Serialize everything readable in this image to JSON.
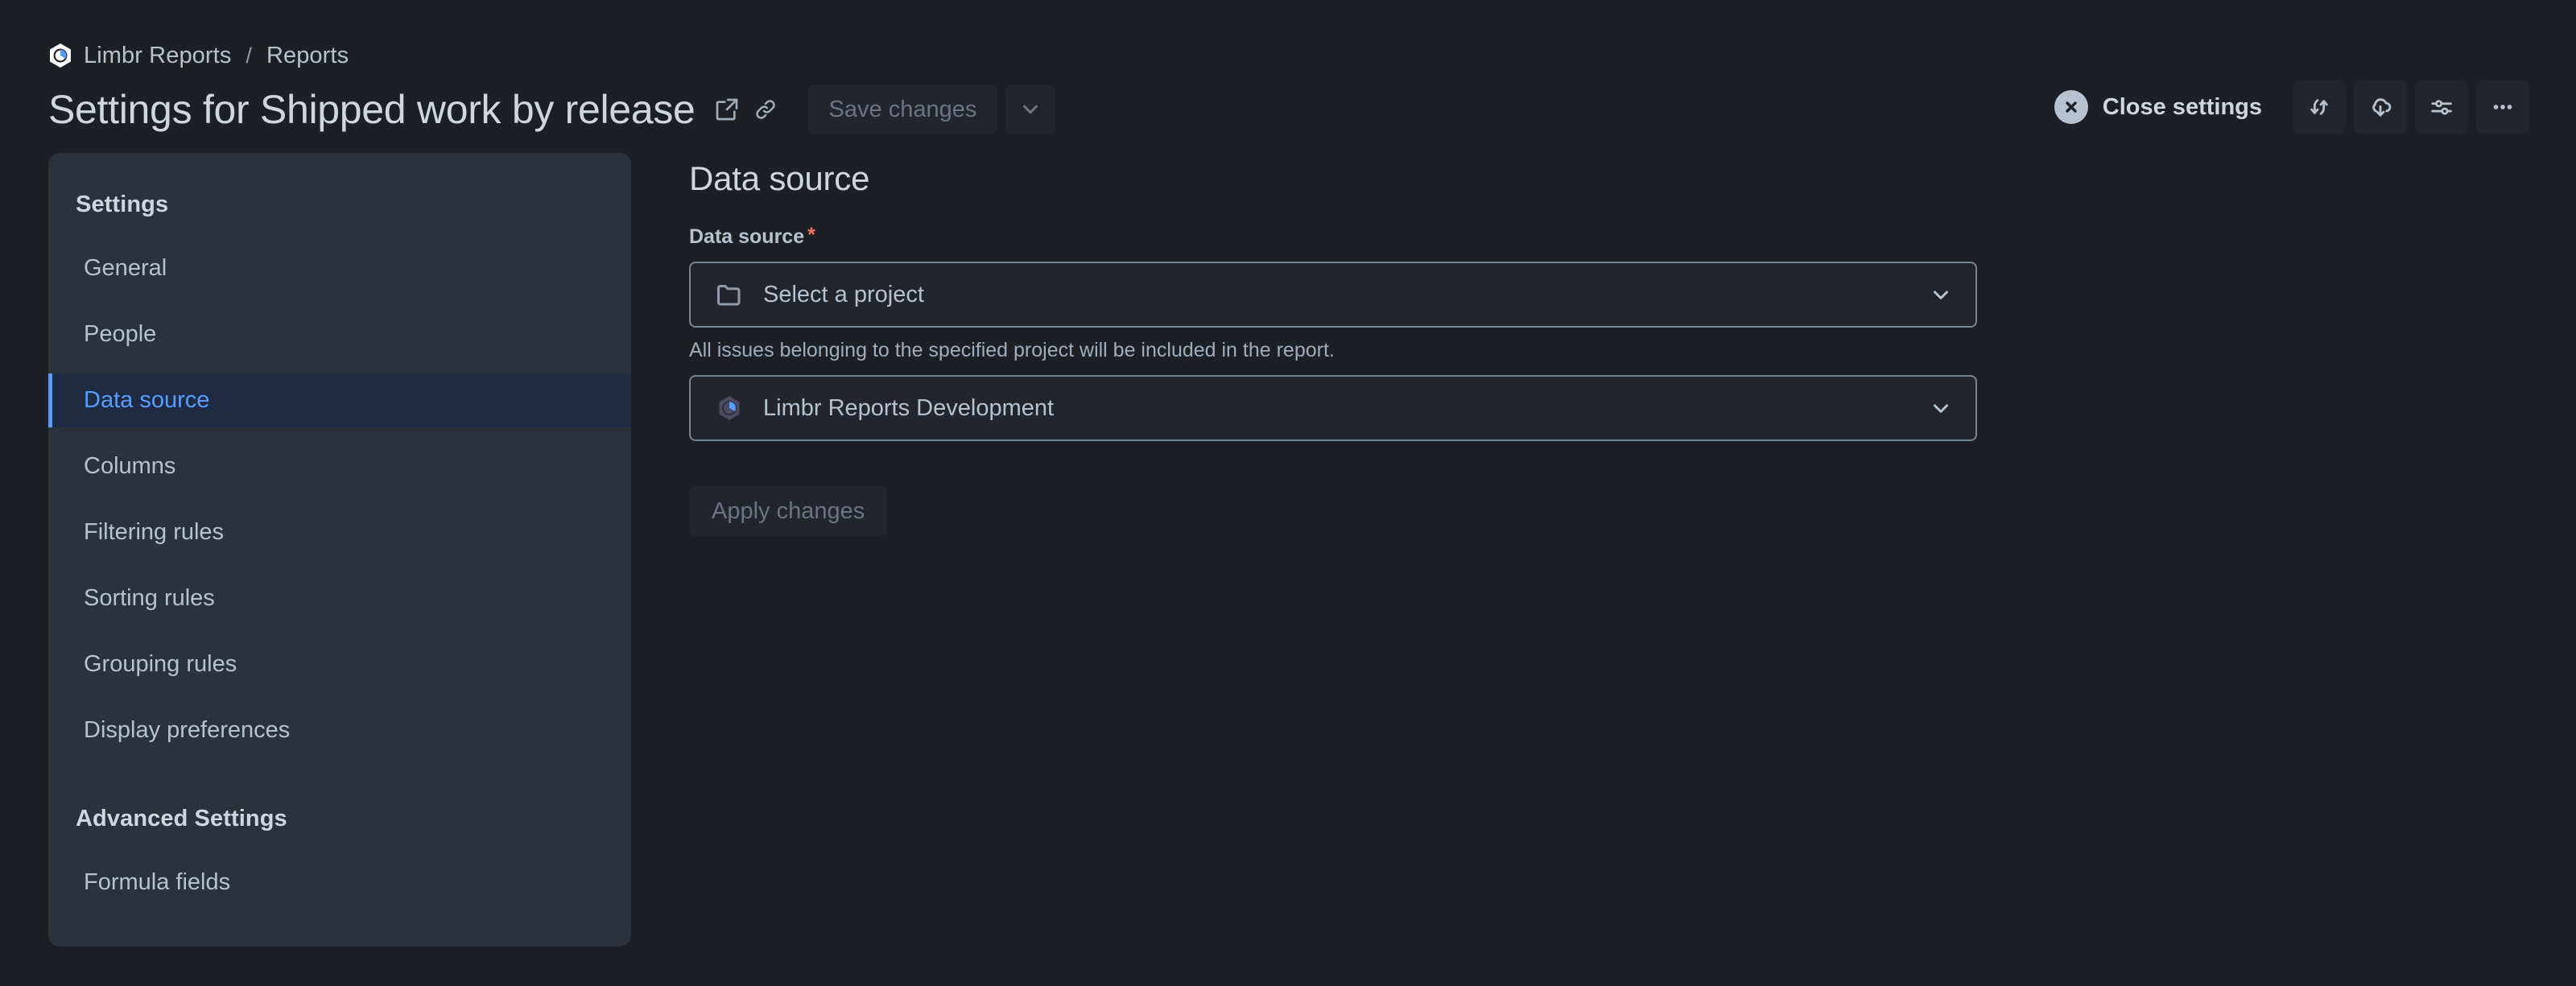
{
  "breadcrumb": {
    "logo_icon": "limbr-hexagon-logo-icon",
    "items": [
      "Limbr Reports",
      "Reports"
    ],
    "separator": "/"
  },
  "header": {
    "title": "Settings for Shipped work by release",
    "open_in_new_icon": "external-link-icon",
    "copy_link_icon": "link-chain-icon",
    "save_label": "Save changes",
    "save_disabled": true,
    "save_caret_icon": "chevron-down-icon",
    "close_settings_label": "Close settings",
    "close_settings_icon": "close-circle-icon",
    "actions": [
      {
        "name": "refresh",
        "icon": "refresh-sync-icon"
      },
      {
        "name": "download",
        "icon": "cloud-download-icon"
      },
      {
        "name": "filters",
        "icon": "sliders-settings-icon"
      },
      {
        "name": "more",
        "icon": "ellipsis-more-icon"
      }
    ]
  },
  "sidebar": {
    "sections": [
      {
        "heading": "Settings",
        "items": [
          {
            "label": "General",
            "active": false
          },
          {
            "label": "People",
            "active": false
          },
          {
            "label": "Data source",
            "active": true
          },
          {
            "label": "Columns",
            "active": false
          },
          {
            "label": "Filtering rules",
            "active": false
          },
          {
            "label": "Sorting rules",
            "active": false
          },
          {
            "label": "Grouping rules",
            "active": false
          },
          {
            "label": "Display preferences",
            "active": false
          }
        ]
      },
      {
        "heading": "Advanced Settings",
        "items": [
          {
            "label": "Formula fields",
            "active": false
          }
        ]
      }
    ]
  },
  "main": {
    "section_title": "Data source",
    "field_label": "Data source",
    "required_marker": "*",
    "project_select": {
      "value": "Select a project",
      "icon": "folder-icon",
      "caret_icon": "chevron-down-icon"
    },
    "helper_text": "All issues belonging to the specified project will be included in the report.",
    "source_select": {
      "value": "Limbr Reports Development",
      "icon": "limbr-hexagon-logo-icon",
      "caret_icon": "chevron-down-icon"
    },
    "apply_label": "Apply changes",
    "apply_disabled": true
  },
  "colors": {
    "page_background": "#1c1f24",
    "sidebar_background": "#2c323b",
    "active_item_background": "#1e2b42",
    "accent_blue": "#579dff",
    "required_red": "#f87168",
    "text_primary": "#cfd6de",
    "text_secondary": "#b6c2cf",
    "text_muted": "#9fadbc",
    "disabled_text": "#6a7485",
    "input_background": "#22262c",
    "input_border": "#738496"
  }
}
